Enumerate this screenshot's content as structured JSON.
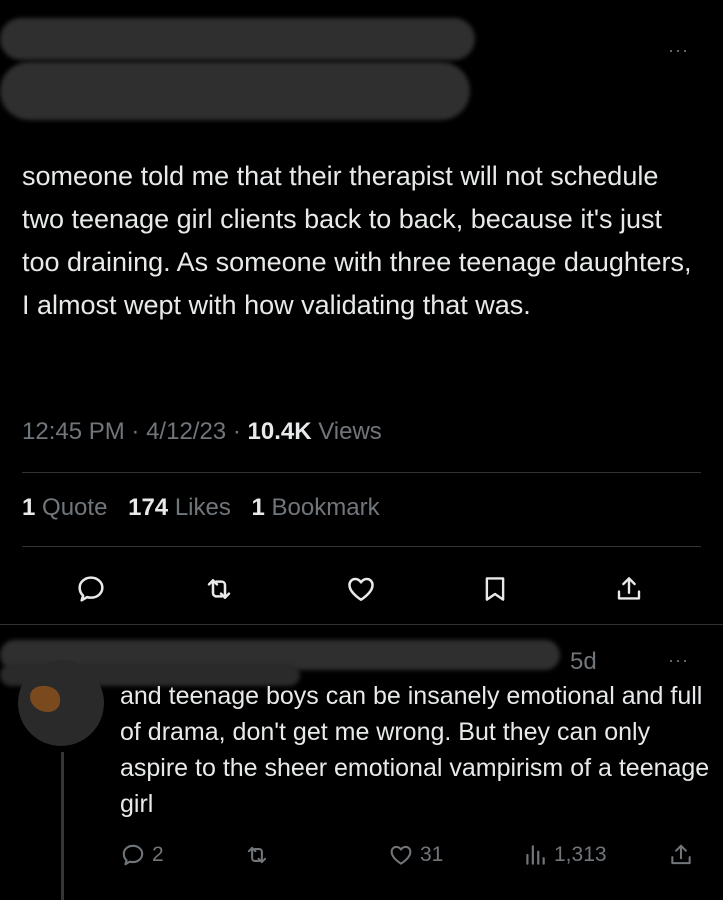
{
  "tweet": {
    "text": "someone told me that their therapist will not schedule two teenage girl clients back to back, because it's just too draining. As someone with three teenage daughters, I almost wept with how validating that was.",
    "time": "12:45 PM",
    "date": "4/12/23",
    "views_count": "10.4K",
    "views_label": "Views",
    "separator": "·"
  },
  "stats": {
    "quotes_count": "1",
    "quotes_label": "Quote",
    "likes_count": "174",
    "likes_label": "Likes",
    "bookmarks_count": "1",
    "bookmarks_label": "Bookmark"
  },
  "icons": {
    "reply": "reply-icon",
    "retweet": "retweet-icon",
    "like": "heart-icon",
    "bookmark": "bookmark-icon",
    "share": "share-icon",
    "more": "more-icon",
    "views": "analytics-icon"
  },
  "reply": {
    "time": "5d",
    "text": "and teenage boys can be insanely emotional and full of drama, don't get me wrong. But they can only aspire to the sheer emotional vampirism of a teenage girl",
    "reply_count": "2",
    "like_count": "31",
    "views_count": "1,313"
  },
  "more_glyph": "···",
  "colors": {
    "background": "#000000",
    "text": "#e7e9ea",
    "muted": "#71767b",
    "divider": "#2f3336"
  }
}
